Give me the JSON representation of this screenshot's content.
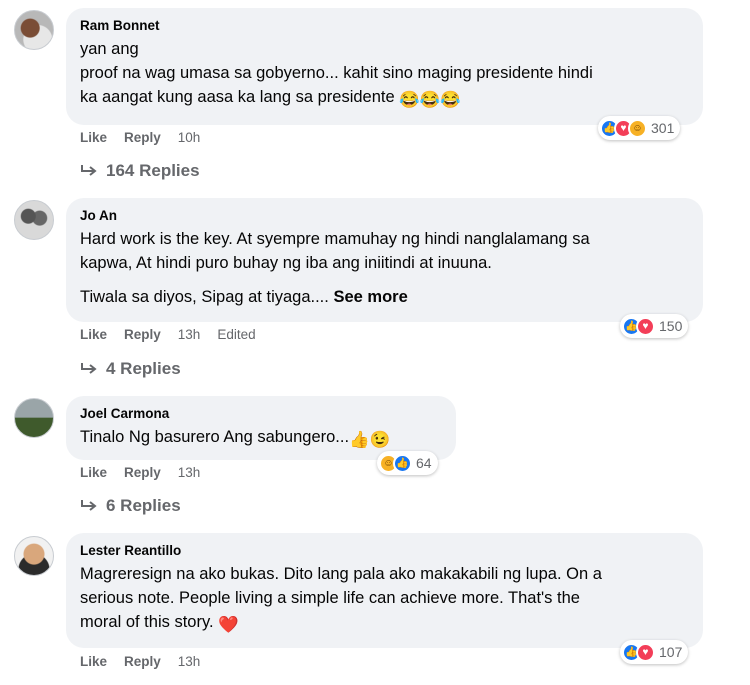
{
  "comments": [
    {
      "author": "Ram Bonnet",
      "lines": [
        "yan ang",
        "proof na wag umasa sa gobyerno... kahit sino maging presidente hindi",
        "ka aangat kung aasa ka lang sa presidente"
      ],
      "emojis": [
        "😂",
        "😂",
        "😂"
      ],
      "like_label": "Like",
      "reply_label": "Reply",
      "time": "10h",
      "reactions": [
        "like",
        "love",
        "haha"
      ],
      "reaction_count": "301",
      "replies_label": "164 Replies"
    },
    {
      "author": "Jo An",
      "lines": [
        "Hard work is the key. At syempre mamuhay ng hindi nanglalamang sa",
        "kapwa, At hindi puro buhay ng iba ang iniitindi at inuuna."
      ],
      "extra_line": "Tiwala sa diyos, Sipag at tiyaga....",
      "see_more": "See more",
      "like_label": "Like",
      "reply_label": "Reply",
      "time": "13h",
      "edited": "Edited",
      "reactions": [
        "like",
        "love"
      ],
      "reaction_count": "150",
      "replies_label": "4 Replies"
    },
    {
      "author": "Joel Carmona",
      "lines": [
        "Tinalo Ng basurero Ang sabungero..."
      ],
      "emojis": [
        "👍",
        "😉"
      ],
      "like_label": "Like",
      "reply_label": "Reply",
      "time": "13h",
      "reactions": [
        "haha",
        "like"
      ],
      "reaction_count": "64",
      "replies_label": "6 Replies"
    },
    {
      "author": "Lester Reantillo",
      "lines": [
        "Magreresign na ako bukas. Dito lang pala ako makakabili ng lupa. On a",
        "serious note. People living a simple life can achieve more. That's the",
        "moral of this story."
      ],
      "emojis": [
        "❤️"
      ],
      "like_label": "Like",
      "reply_label": "Reply",
      "time": "13h",
      "reactions": [
        "like",
        "love"
      ],
      "reaction_count": "107"
    }
  ],
  "icons": {
    "like": "thumbs-up-icon",
    "love": "heart-icon",
    "haha": "laughing-face-icon",
    "reply_arrow": "reply-arrow-icon"
  },
  "colors": {
    "bubble": "#f0f2f5",
    "like_blue": "#1877f2",
    "love_red": "#f33e58",
    "haha_yellow": "#f7b125",
    "meta_gray": "#65676b"
  }
}
